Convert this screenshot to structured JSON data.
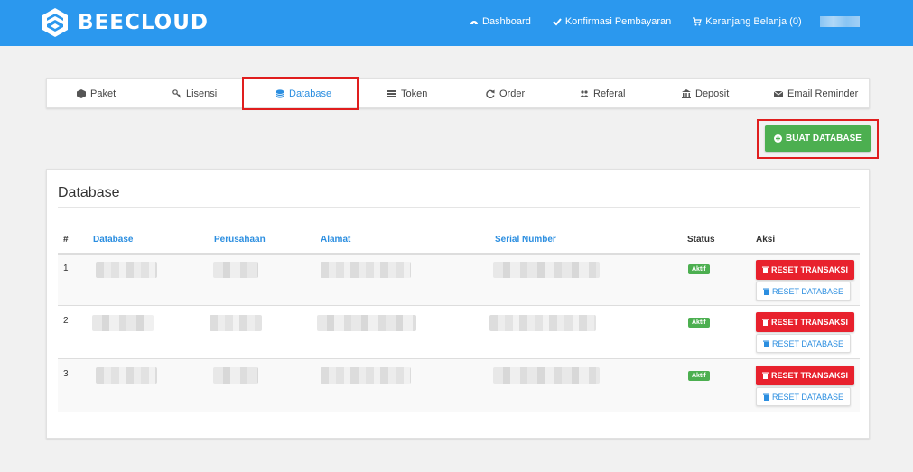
{
  "brand": {
    "name": "BEECLOUD",
    "accent": "#2b98ee"
  },
  "topnav": [
    {
      "label": "Dashboard",
      "icon": "dashboard-icon"
    },
    {
      "label": "Konfirmasi Pembayaran",
      "icon": "check-icon"
    },
    {
      "label": "Keranjang Belanja (0)",
      "icon": "cart-icon"
    }
  ],
  "tabs": [
    {
      "label": "Paket",
      "icon": "box-icon"
    },
    {
      "label": "Lisensi",
      "icon": "key-icon"
    },
    {
      "label": "Database",
      "icon": "database-icon",
      "active": true
    },
    {
      "label": "Token",
      "icon": "list-icon"
    },
    {
      "label": "Order",
      "icon": "refresh-icon"
    },
    {
      "label": "Referal",
      "icon": "users-icon"
    },
    {
      "label": "Deposit",
      "icon": "bank-icon"
    },
    {
      "label": "Email Reminder",
      "icon": "envelope-icon"
    }
  ],
  "create_button": {
    "label": "BUAT DATABASE",
    "icon": "plus-circle-icon",
    "color": "#4caf50"
  },
  "card": {
    "title": "Database",
    "columns": [
      "#",
      "Database",
      "Perusahaan",
      "Alamat",
      "Serial Number",
      "Status",
      "Aksi"
    ],
    "rows": [
      {
        "num": "1",
        "status": "Aktif",
        "reset_trx": "RESET TRANSAKSI",
        "reset_db": "RESET DATABASE"
      },
      {
        "num": "2",
        "status": "Aktif",
        "reset_trx": "RESET TRANSAKSI",
        "reset_db": "RESET DATABASE"
      },
      {
        "num": "3",
        "status": "Aktif",
        "reset_trx": "RESET TRANSAKSI",
        "reset_db": "RESET DATABASE"
      }
    ]
  },
  "colors": {
    "danger": "#e8212d",
    "success": "#4caf50",
    "link": "#2b8ee0",
    "highlight": "#e01e1e"
  }
}
